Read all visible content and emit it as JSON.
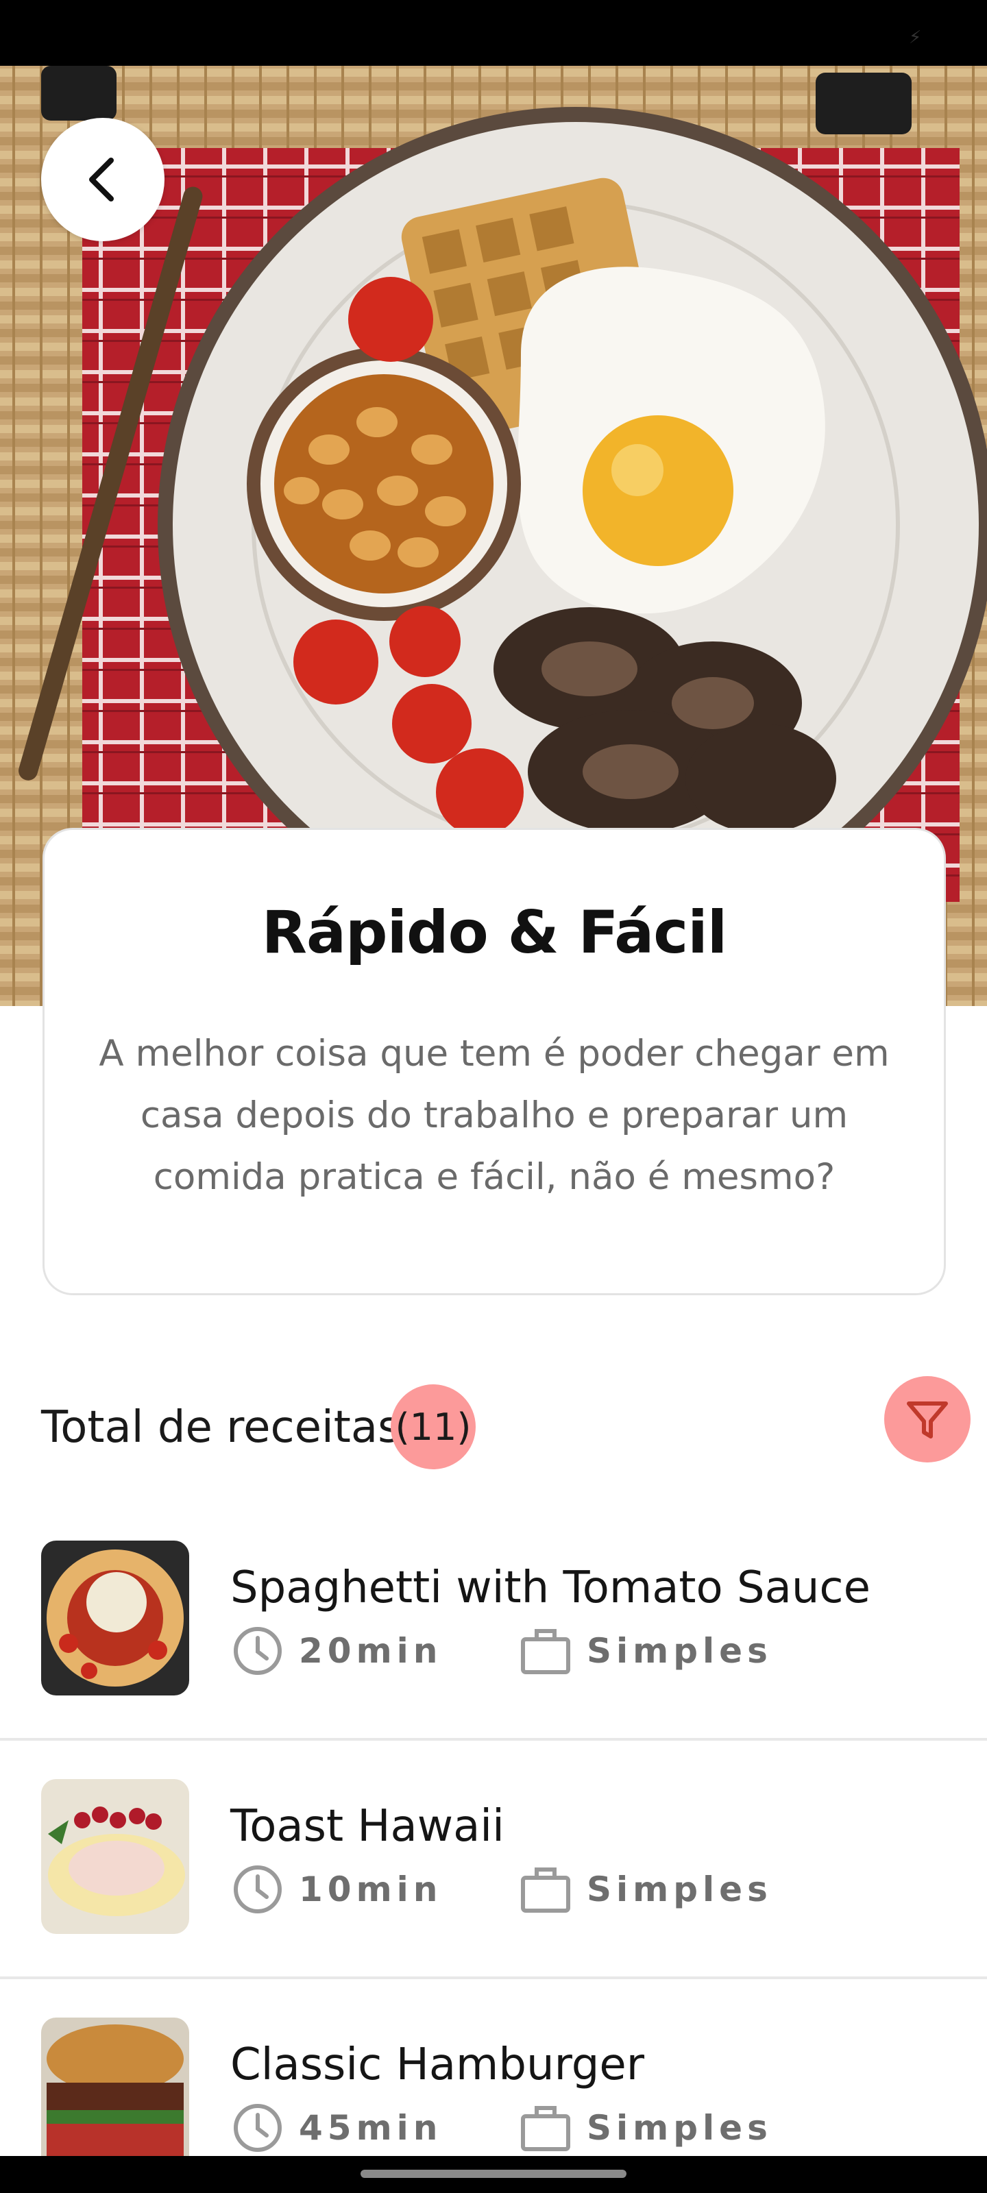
{
  "header": {
    "back_icon": "chevron-left-icon"
  },
  "intro": {
    "title": "Rápido & Fácil",
    "description": "A melhor coisa que tem é poder chegar em casa depois do trabalho e preparar um comida pratica e fácil, não é mesmo?"
  },
  "total": {
    "label": "Total de receitas",
    "count": "(11)",
    "filter_icon": "filter-funnel-icon"
  },
  "recipes": [
    {
      "name": "Spaghetti with Tomato Sauce",
      "time": "20min",
      "complexity": "Simples"
    },
    {
      "name": "Toast Hawaii",
      "time": "10min",
      "complexity": "Simples"
    },
    {
      "name": "Classic Hamburger",
      "time": "45min",
      "complexity": "Simples"
    }
  ],
  "colors": {
    "accent": "#fc9a9a",
    "meta_text": "#6e6e6e",
    "divider": "#e8e8e8"
  }
}
